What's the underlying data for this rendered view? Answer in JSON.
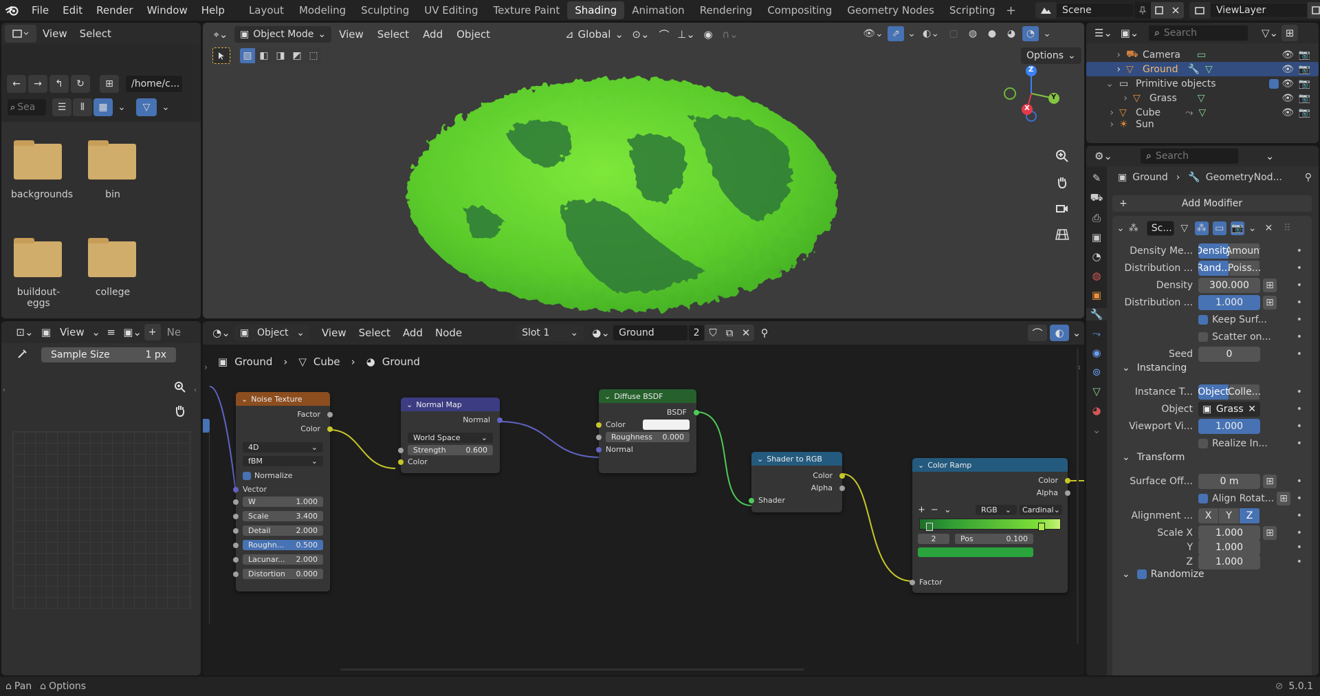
{
  "topbar": {
    "menus": [
      "File",
      "Edit",
      "Render",
      "Window",
      "Help"
    ],
    "workspaces": [
      "Layout",
      "Modeling",
      "Sculpting",
      "UV Editing",
      "Texture Paint",
      "Shading",
      "Animation",
      "Rendering",
      "Compositing",
      "Geometry Nodes",
      "Scripting"
    ],
    "active_workspace": "Shading",
    "scene": "Scene",
    "view_layer": "ViewLayer"
  },
  "filebrowser": {
    "menus": [
      "View",
      "Select"
    ],
    "path": "/home/c...",
    "search_placeholder": "Sea",
    "folders": [
      "backgrounds",
      "bin",
      "buildout-eggs",
      "college"
    ]
  },
  "imageeditor": {
    "view_label": "View",
    "new_label": "Ne",
    "sample_label": "Sample Size",
    "sample_value": "1 px"
  },
  "viewport": {
    "mode": "Object Mode",
    "menus": [
      "View",
      "Select",
      "Add",
      "Object"
    ],
    "transform": "Global",
    "options": "Options",
    "gizmo": {
      "z": "Z",
      "y": "Y",
      "x": "X"
    }
  },
  "nodeeditor": {
    "type": "Object",
    "menus": [
      "View",
      "Select",
      "Add",
      "Node"
    ],
    "slot": "Slot 1",
    "material": "Ground",
    "users": "2",
    "breadcrumb": [
      "Ground",
      "Cube",
      "Ground"
    ]
  },
  "nodes": {
    "noise": {
      "title": "Noise Texture",
      "out1": "Factor",
      "out2": "Color",
      "dim": "4D",
      "type": "fBM",
      "normalize": "Normalize",
      "vector": "Vector",
      "fields": [
        [
          "W",
          "1.000"
        ],
        [
          "Scale",
          "3.400"
        ],
        [
          "Detail",
          "2.000"
        ],
        [
          "Roughn...",
          "0.500"
        ],
        [
          "Lacunar...",
          "2.000"
        ],
        [
          "Distortion",
          "0.000"
        ]
      ]
    },
    "normalmap": {
      "title": "Normal Map",
      "out": "Normal",
      "space": "World Space",
      "strength_label": "Strength",
      "strength": "0.600",
      "in": "Color"
    },
    "diffuse": {
      "title": "Diffuse BSDF",
      "out": "BSDF",
      "color": "Color",
      "rough_label": "Roughness",
      "rough": "0.000",
      "normal": "Normal"
    },
    "shader2rgb": {
      "title": "Shader to RGB",
      "out1": "Color",
      "out2": "Alpha",
      "in": "Shader"
    },
    "colorramp": {
      "title": "Color Ramp",
      "out1": "Color",
      "out2": "Alpha",
      "mode": "RGB",
      "interp": "Cardinal",
      "index": "2",
      "pos_label": "Pos",
      "pos": "0.100",
      "in": "Factor"
    }
  },
  "outliner": {
    "search_placeholder": "Search",
    "items": [
      {
        "label": "Camera",
        "indent": 0
      },
      {
        "label": "Ground",
        "indent": 0,
        "selected": true
      },
      {
        "label": "Primitive objects",
        "indent": -1
      },
      {
        "label": "Grass",
        "indent": 0
      },
      {
        "label": "Cube",
        "indent": -1
      },
      {
        "label": "Sun",
        "indent": -1
      }
    ]
  },
  "properties": {
    "search_placeholder": "Search",
    "breadcrumb_obj": "Ground",
    "breadcrumb_mod": "GeometryNod...",
    "add_modifier": "Add Modifier",
    "modifier_name": "Sc...",
    "rows": {
      "density_method": {
        "label": "Density Me...",
        "a": "Density",
        "b": "Amount"
      },
      "distribution": {
        "label": "Distribution ...",
        "a": "Rand...",
        "b": "Poiss..."
      },
      "density": {
        "label": "Density",
        "value": "300.000"
      },
      "distribution2": {
        "label": "Distribution ...",
        "value": "1.000"
      },
      "keep_surf": "Keep Surf...",
      "scatter": "Scatter on...",
      "seed": {
        "label": "Seed",
        "value": "0"
      },
      "instancing": "Instancing",
      "instance_type": {
        "label": "Instance T...",
        "a": "Object",
        "b": "Colle..."
      },
      "object": {
        "label": "Object",
        "value": "Grass"
      },
      "viewport_vis": {
        "label": "Viewport Vi...",
        "value": "1.000"
      },
      "realize": "Realize In...",
      "transform": "Transform",
      "surface_off": {
        "label": "Surface Off...",
        "value": "0 m"
      },
      "align_rot": "Align Rotat...",
      "alignment": {
        "label": "Alignment ...",
        "x": "X",
        "y": "Y",
        "z": "Z"
      },
      "scale_x": {
        "label": "Scale X",
        "value": "1.000"
      },
      "scale_y": {
        "label": "Y",
        "value": "1.000"
      },
      "scale_z": {
        "label": "Z",
        "value": "1.000"
      },
      "randomize": "Randomize"
    }
  },
  "statusbar": {
    "pan": "Pan",
    "options": "Options",
    "version": "5.0.1"
  },
  "colors": {
    "accent": "#4772b3",
    "noise_header": "#8c4d1f",
    "normalmap_header": "#3c3c83",
    "diffuse_header": "#26602c",
    "shader_header": "#245a7e",
    "ramp_header": "#245a7e"
  }
}
